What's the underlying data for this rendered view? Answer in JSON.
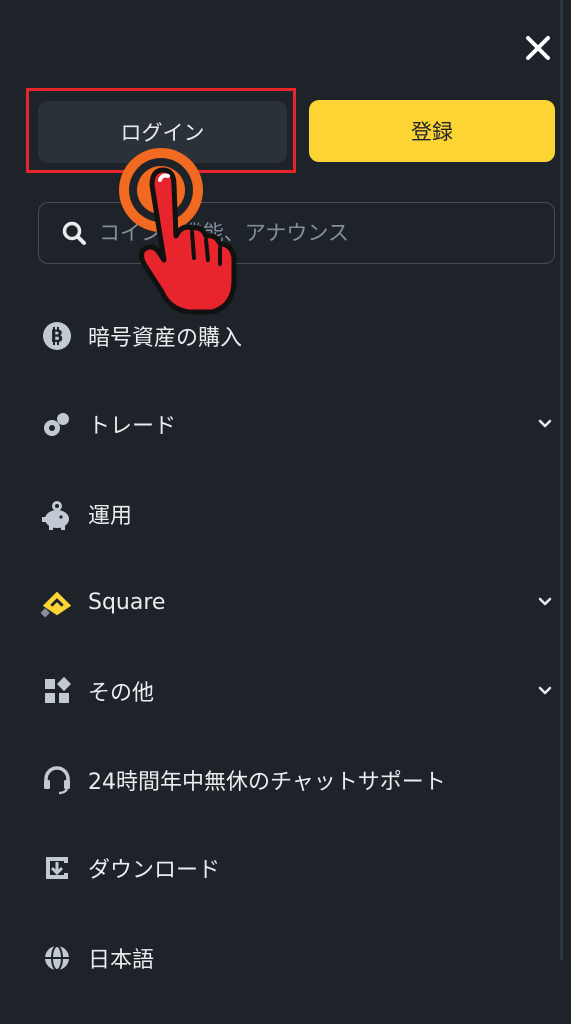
{
  "header": {
    "close_icon": "close-icon",
    "login_label": "ログイン",
    "register_label": "登録"
  },
  "search": {
    "placeholder": "コイン、機能、アナウンス"
  },
  "menu": {
    "items": [
      {
        "label": "暗号資産の購入",
        "icon": "bitcoin-icon",
        "expandable": false
      },
      {
        "label": "トレード",
        "icon": "trade-icon",
        "expandable": true
      },
      {
        "label": "運用",
        "icon": "piggy-bank-icon",
        "expandable": false
      },
      {
        "label": "Square",
        "icon": "square-icon",
        "expandable": true
      },
      {
        "label": "その他",
        "icon": "grid-icon",
        "expandable": true
      },
      {
        "label": "24時間年中無休のチャットサポート",
        "icon": "headset-icon",
        "expandable": false
      },
      {
        "label": "ダウンロード",
        "icon": "download-icon",
        "expandable": false
      },
      {
        "label": "日本語",
        "icon": "globe-icon",
        "expandable": false
      }
    ]
  },
  "colors": {
    "background": "#1e2329",
    "primary": "#fcd535",
    "highlight": "#e8242c",
    "pointer": "#e8242c",
    "pointer_ring": "#f26a22"
  }
}
